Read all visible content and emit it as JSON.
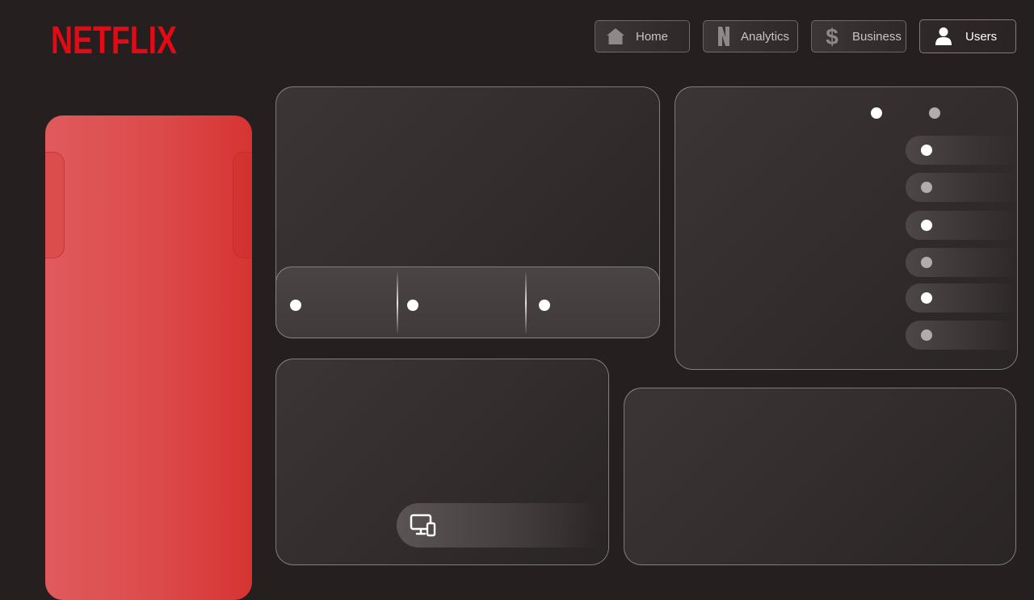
{
  "brand": {
    "name": "NETFLIX",
    "color": "#e50914"
  },
  "nav": [
    {
      "id": "home",
      "label": "Home",
      "icon": "home-icon",
      "active": false
    },
    {
      "id": "analytics",
      "label": "Analytics",
      "icon": "netflix-n-icon",
      "active": false
    },
    {
      "id": "business",
      "label": "Business",
      "icon": "dollar-icon",
      "active": false
    },
    {
      "id": "users",
      "label": "Users",
      "icon": "user-icon",
      "active": true
    }
  ],
  "theme": {
    "background": "#261f1f",
    "accent_red": "#dc4a4a",
    "card": "#363030"
  },
  "widgets": {
    "device_indicator_icon": "devices-icon"
  }
}
